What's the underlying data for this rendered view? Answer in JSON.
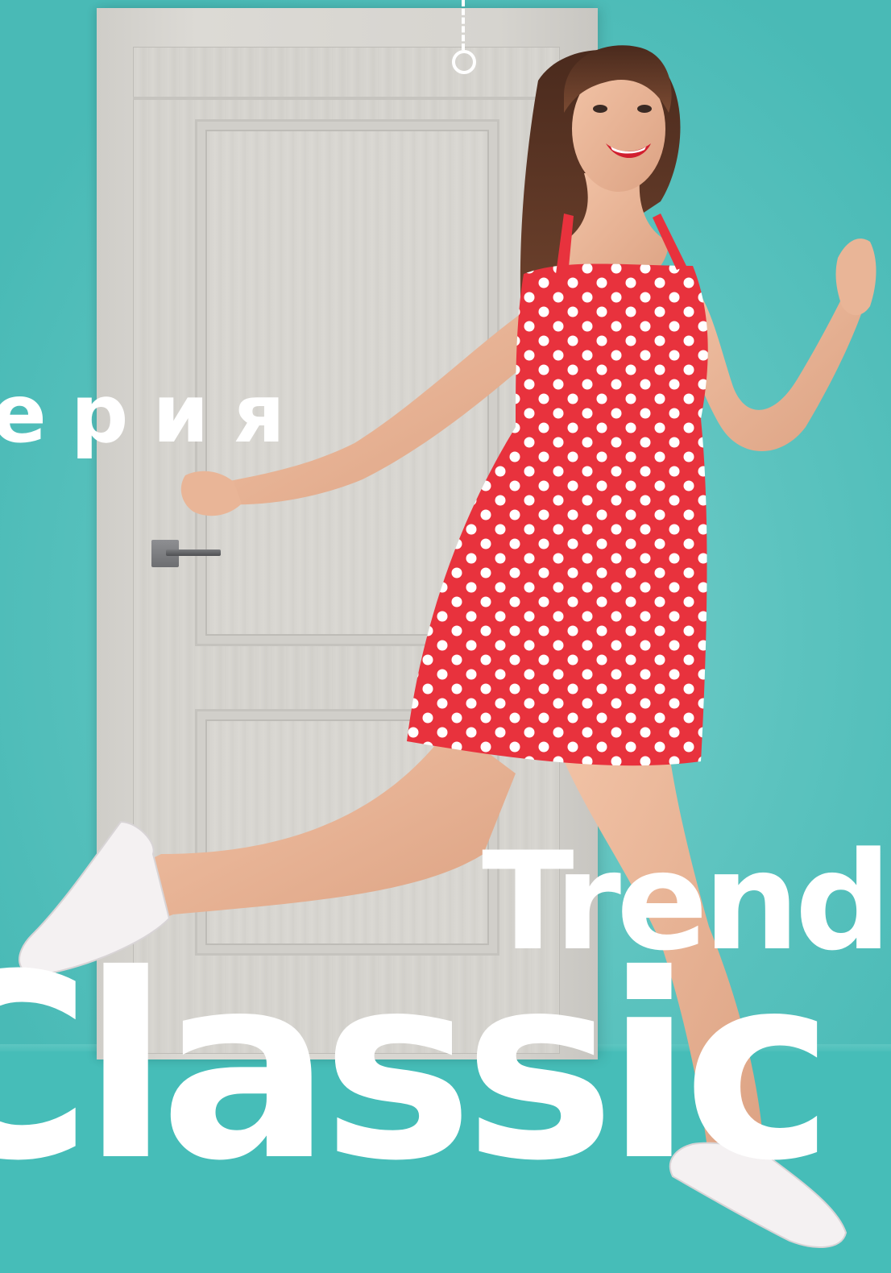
{
  "brochure": {
    "series_label": "ерия",
    "title_line1": "Trend",
    "title_line2": "Classic"
  },
  "colors": {
    "background": "#5cc3bf",
    "floor": "#46bdb8",
    "text": "#ffffff",
    "dress": "#e8323d",
    "door": "#d6d4cf"
  },
  "icons": {
    "hook": "hook-ring-icon",
    "door_handle": "door-handle-icon"
  }
}
